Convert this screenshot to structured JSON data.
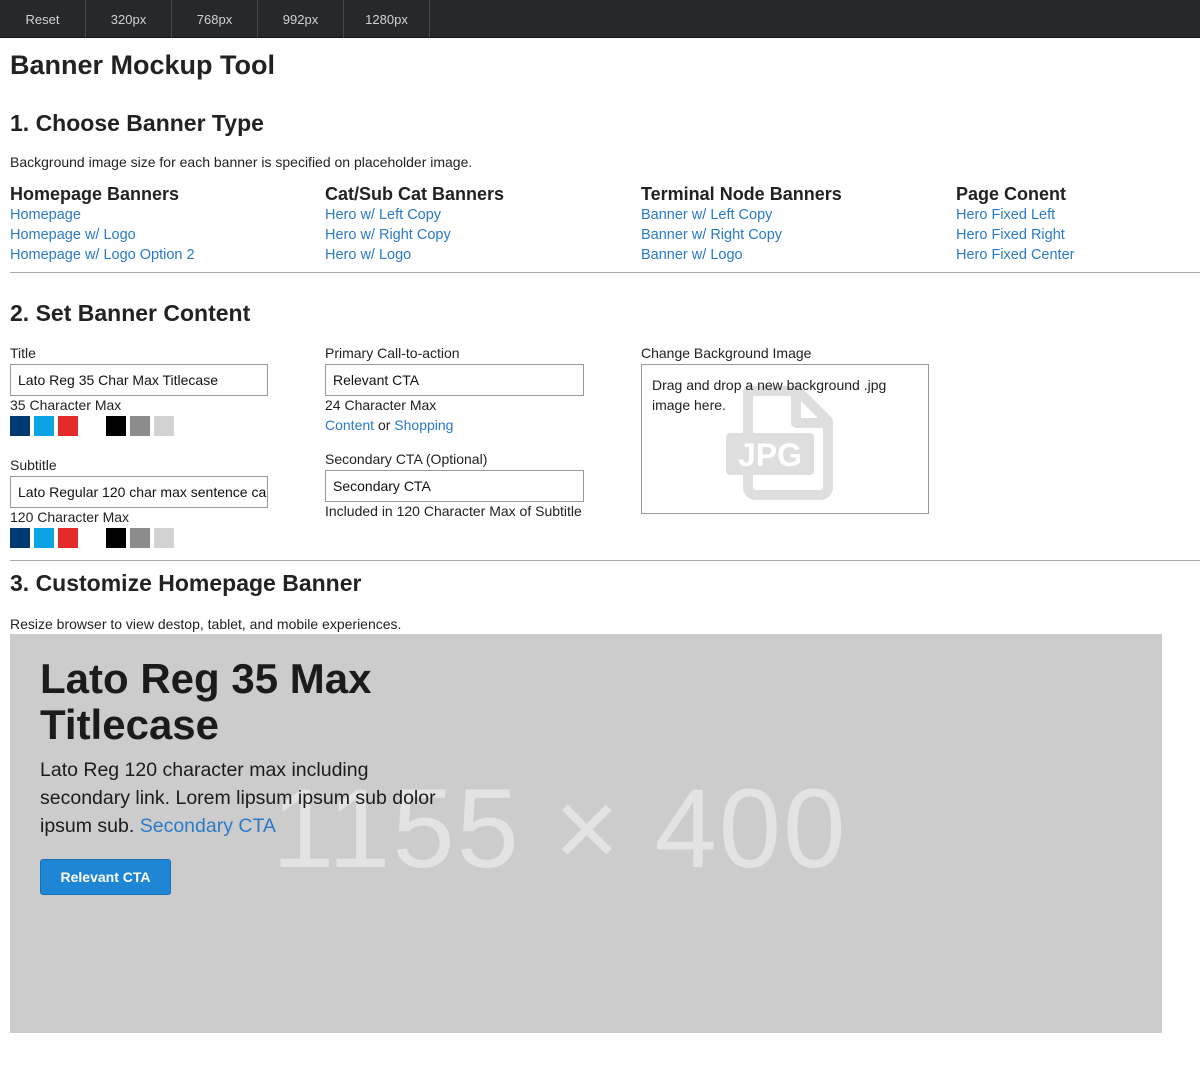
{
  "topbar": {
    "buttons": [
      "Reset",
      "320px",
      "768px",
      "992px",
      "1280px"
    ]
  },
  "page_title": "Banner Mockup Tool",
  "section1": {
    "title": "1. Choose Banner Type",
    "note": "Background image size for each banner is specified on placeholder image.",
    "columns": [
      {
        "heading": "Homepage Banners",
        "links": [
          "Homepage",
          "Homepage w/ Logo",
          "Homepage w/ Logo Option 2"
        ]
      },
      {
        "heading": "Cat/Sub Cat Banners",
        "links": [
          "Hero w/ Left Copy",
          "Hero w/ Right Copy",
          "Hero w/ Logo"
        ]
      },
      {
        "heading": "Terminal Node Banners",
        "links": [
          "Banner w/ Left Copy",
          "Banner w/ Right Copy",
          "Banner w/ Logo"
        ]
      },
      {
        "heading": "Page Conent",
        "links": [
          "Hero Fixed Left",
          "Hero Fixed Right",
          "Hero Fixed Center"
        ]
      }
    ]
  },
  "section2": {
    "title": "2. Set Banner Content",
    "title_field": {
      "label": "Title",
      "value": "Lato Reg 35 Char Max Titlecase",
      "hint": "35 Character Max"
    },
    "subtitle_field": {
      "label": "Subtitle",
      "value": "Lato Regular 120 char max sentence ca",
      "hint": "120 Character Max"
    },
    "swatch_colors": [
      "#003a70",
      "#0ba3e3",
      "#e42b2b",
      "#000000",
      "#8c8c8c",
      "#d2d2d2"
    ],
    "primary_cta": {
      "label": "Primary Call-to-action",
      "value": "Relevant CTA",
      "hint": "24 Character Max",
      "link_content": "Content",
      "or_text": "or",
      "link_shopping": "Shopping"
    },
    "secondary_cta": {
      "label": "Secondary CTA (Optional)",
      "value": "Secondary CTA",
      "hint": "Included in 120 Character Max of Subtitle"
    },
    "background": {
      "label": "Change Background Image",
      "dropzone_text": "Drag and drop a new background .jpg image here.",
      "icon": "jpg-file-icon",
      "icon_text": "JPG"
    }
  },
  "section3": {
    "title": "3. Customize Homepage Banner",
    "note": "Resize browser to view destop, tablet, and mobile experiences."
  },
  "banner": {
    "placeholder": "1155 × 400",
    "title": "Lato Reg 35 Max Titlecase",
    "subtitle": "Lato Reg 120 character max including secondary link. Lorem lipsum ipsum sub dolor ipsum sub.",
    "secondary_link": "Secondary CTA",
    "cta": "Relevant CTA",
    "background_color": "#cccccc",
    "cta_color": "#1f86d6",
    "link_color": "#2a7ac8"
  }
}
